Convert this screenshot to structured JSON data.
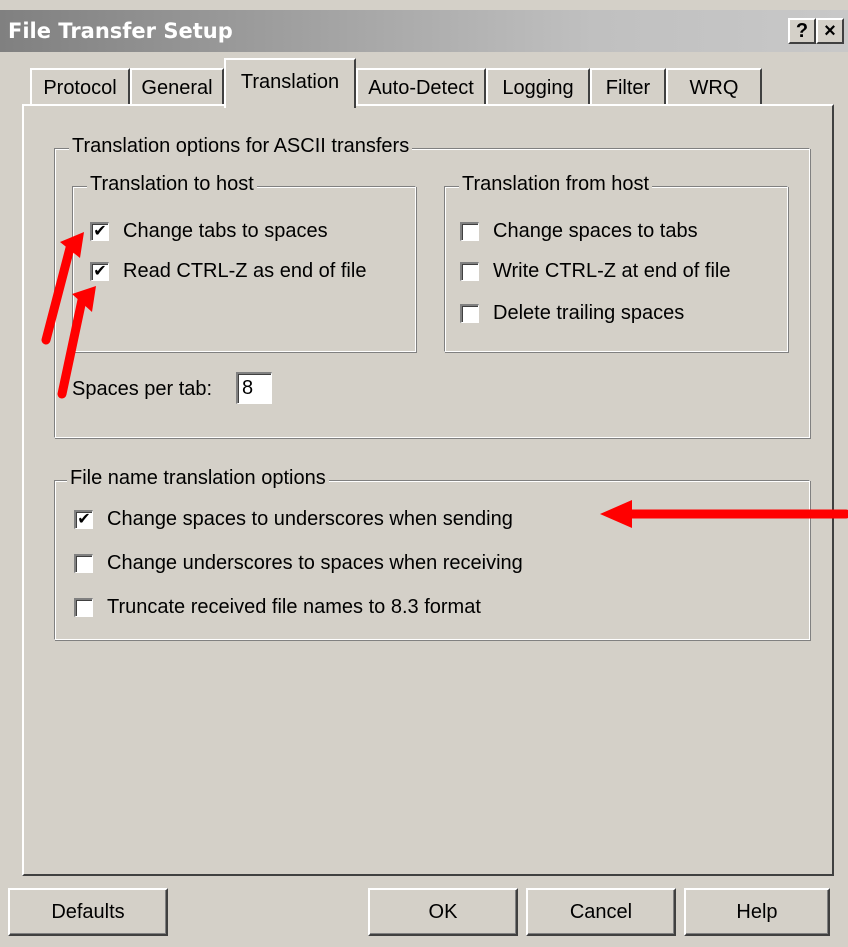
{
  "window": {
    "title": "File Transfer Setup",
    "help_btn": "?",
    "close_btn": "×"
  },
  "tabs": [
    {
      "label": "Protocol",
      "active": false
    },
    {
      "label": "General",
      "active": false
    },
    {
      "label": "Translation",
      "active": true
    },
    {
      "label": "Auto-Detect",
      "active": false
    },
    {
      "label": "Logging",
      "active": false
    },
    {
      "label": "Filter",
      "active": false
    },
    {
      "label": "WRQ",
      "active": false
    }
  ],
  "ascii_group": {
    "label": "Translation options for ASCII transfers",
    "to_host": {
      "label": "Translation to host",
      "options": [
        {
          "label": "Change tabs to spaces",
          "checked": true
        },
        {
          "label": "Read CTRL-Z as end of file",
          "checked": true
        }
      ]
    },
    "from_host": {
      "label": "Translation from host",
      "options": [
        {
          "label": "Change spaces to tabs",
          "checked": false
        },
        {
          "label": "Write CTRL-Z at end of file",
          "checked": false
        },
        {
          "label": "Delete trailing spaces",
          "checked": false
        }
      ]
    },
    "spaces_per_tab": {
      "label": "Spaces per tab:",
      "value": "8"
    }
  },
  "filename_group": {
    "label": "File name translation options",
    "options": [
      {
        "label": "Change spaces to underscores when sending",
        "checked": true
      },
      {
        "label": "Change underscores to spaces when receiving",
        "checked": false
      },
      {
        "label": "Truncate received file names to 8.3 format",
        "checked": false
      }
    ]
  },
  "buttons": {
    "defaults": "Defaults",
    "ok": "OK",
    "cancel": "Cancel",
    "help": "Help"
  },
  "checkmark_glyph": "✔",
  "annotation_color": "#ff0000"
}
